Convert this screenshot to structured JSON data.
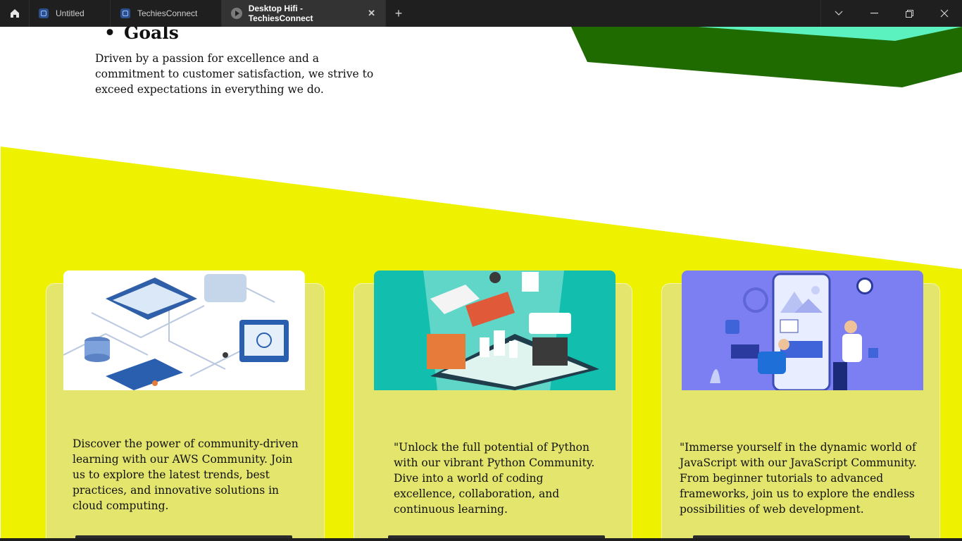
{
  "browser": {
    "home_icon": "home-icon",
    "tabs": [
      {
        "label": "Untitled",
        "icon": "figma-file-icon"
      },
      {
        "label": "TechiesConnect",
        "icon": "figma-file-icon"
      },
      {
        "label": "Desktop Hifi - TechiesConnect",
        "icon": "prototype-play-icon",
        "active": true
      }
    ],
    "close_glyph": "✕",
    "new_tab_glyph": "+",
    "controls": [
      "chevron-down-icon",
      "minimize-icon",
      "restore-icon",
      "close-icon"
    ]
  },
  "page": {
    "goals_heading": "Goals",
    "goals_text": "Driven by a passion for excellence and a commitment to customer satisfaction, we strive to exceed expectations in everything we do.",
    "colors": {
      "yellow": "#eef200",
      "dark_green": "#1f6b00",
      "mint": "#5cf2c0",
      "card": "#e3e56d",
      "button": "#2b2b2b"
    },
    "cards": [
      {
        "name": "aws-community",
        "image": "cloud-network-isometric-illustration",
        "text": "Discover the power of community-driven learning with our AWS Community. Join us to explore the latest trends, best practices, and innovative solutions in cloud computing."
      },
      {
        "name": "python-community",
        "image": "isometric-tech-devices-illustration",
        "text": "\"Unlock the full potential of Python with our vibrant Python Community. Dive into a world of coding excellence, collaboration, and continuous learning."
      },
      {
        "name": "javascript-community",
        "image": "mobile-app-developers-illustration",
        "text": "\"Immerse yourself in the dynamic world of JavaScript with our JavaScript Community. From beginner tutorials to advanced frameworks, join us to explore the endless possibilities of web development."
      }
    ]
  }
}
